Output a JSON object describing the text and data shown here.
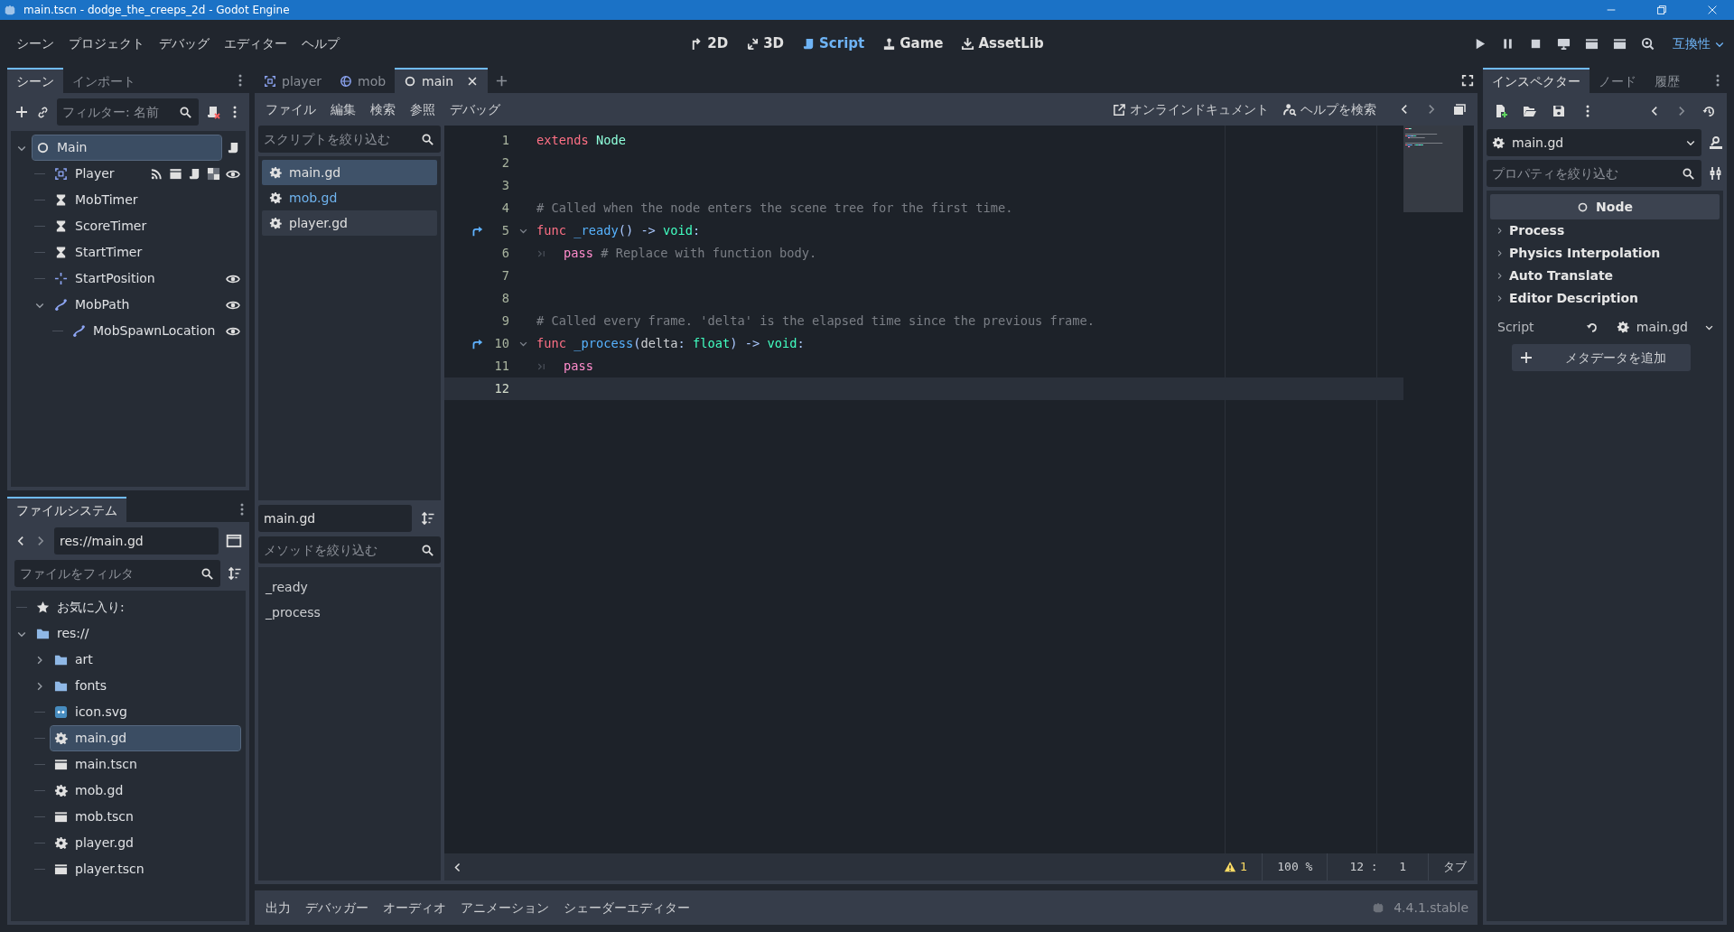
{
  "window": {
    "title": "main.tscn - dodge_the_creeps_2d - Godot Engine"
  },
  "menu": [
    "シーン",
    "プロジェクト",
    "デバッグ",
    "エディター",
    "ヘルプ"
  ],
  "workspaces": [
    {
      "kind": "flat",
      "label": "2D",
      "selected": false
    },
    {
      "kind": "spatial",
      "label": "3D",
      "selected": false
    },
    {
      "kind": "script",
      "label": "Script",
      "selected": true
    },
    {
      "kind": "game",
      "label": "Game",
      "selected": false
    },
    {
      "kind": "assetlib",
      "label": "AssetLib",
      "selected": false
    }
  ],
  "renderer": "互換性",
  "scene_dock": {
    "tabs": [
      {
        "label": "シーン",
        "selected": true
      },
      {
        "label": "インポート",
        "selected": false
      }
    ],
    "filter": {
      "placeholder": "フィルター: 名前"
    },
    "tree": [
      {
        "name": "Main",
        "kind": "node",
        "selected": true,
        "expanded": true,
        "signals": false,
        "groups": false,
        "script": true,
        "editable": false,
        "children": [
          {
            "name": "Player",
            "kind": "area",
            "selected": false,
            "signals": true,
            "groups": true,
            "script": true,
            "editable": true,
            "visible": true
          },
          {
            "name": "MobTimer",
            "kind": "timer",
            "selected": false,
            "signals": false,
            "groups": false,
            "script": false,
            "editable": false
          },
          {
            "name": "ScoreTimer",
            "kind": "timer",
            "selected": false,
            "signals": false,
            "groups": false,
            "script": false,
            "editable": false
          },
          {
            "name": "StartTimer",
            "kind": "timer",
            "selected": false,
            "signals": false,
            "groups": false,
            "script": false,
            "editable": false
          },
          {
            "name": "StartPosition",
            "kind": "marker",
            "selected": false,
            "signals": false,
            "groups": false,
            "script": false,
            "editable": false,
            "visible": true
          },
          {
            "name": "MobPath",
            "kind": "path",
            "selected": false,
            "expanded": true,
            "signals": false,
            "groups": false,
            "script": false,
            "editable": false,
            "visible": true,
            "children": [
              {
                "name": "MobSpawnLocation",
                "kind": "path_follow",
                "selected": false,
                "signals": false,
                "groups": false,
                "script": false,
                "editable": false,
                "visible": true
              }
            ]
          }
        ]
      }
    ]
  },
  "filesystem": {
    "tab": "ファイルシステム",
    "path": "res://main.gd",
    "filter": {
      "placeholder": "ファイルをフィルタ"
    },
    "tree": [
      {
        "kind": "favorites",
        "name": "お気に入り:",
        "selected": false
      },
      {
        "kind": "folder",
        "name": "res://",
        "selected": false,
        "expanded": true,
        "children": [
          {
            "kind": "folder",
            "name": "art",
            "selected": false,
            "expanded": false
          },
          {
            "kind": "folder",
            "name": "fonts",
            "selected": false,
            "expanded": false
          },
          {
            "kind": "image",
            "name": "icon.svg",
            "selected": false
          },
          {
            "kind": "script",
            "name": "main.gd",
            "selected": true
          },
          {
            "kind": "scene",
            "name": "main.tscn",
            "selected": false
          },
          {
            "kind": "script",
            "name": "mob.gd",
            "selected": false
          },
          {
            "kind": "scene",
            "name": "mob.tscn",
            "selected": false
          },
          {
            "kind": "script",
            "name": "player.gd",
            "selected": false
          },
          {
            "kind": "scene",
            "name": "player.tscn",
            "selected": false
          }
        ]
      }
    ]
  },
  "editor_tabs": [
    {
      "kind": "scene2d",
      "label": "player",
      "selected": false
    },
    {
      "kind": "rigid",
      "label": "mob",
      "selected": false
    },
    {
      "kind": "node",
      "label": "main",
      "selected": true
    }
  ],
  "script_menu": [
    "ファイル",
    "編集",
    "検索",
    "参照",
    "デバッグ"
  ],
  "script_links": [
    {
      "kind": "external",
      "label": "オンラインドキュメント"
    },
    {
      "kind": "help",
      "label": "ヘルプを検索"
    }
  ],
  "script_list": {
    "filter": {
      "placeholder": "スクリプトを絞り込む"
    },
    "items": [
      {
        "name": "main.gd",
        "selected": true,
        "hovered": false,
        "highlighted": false
      },
      {
        "name": "mob.gd",
        "selected": false,
        "hovered": false,
        "highlighted": true
      },
      {
        "name": "player.gd",
        "selected": false,
        "hovered": true,
        "highlighted": false
      }
    ]
  },
  "current_script": "main.gd",
  "method_filter": {
    "placeholder": "メソッドを絞り込む"
  },
  "methods": [
    "_ready",
    "_process"
  ],
  "code": {
    "lines": [
      {
        "number": "1",
        "connected": false,
        "foldable": false,
        "indented": false,
        "current": false,
        "tokens": [
          {
            "kind": "keyword",
            "text": "extends"
          },
          {
            "kind": "engine_type",
            "text": " Node"
          }
        ]
      },
      {
        "number": "2",
        "connected": false,
        "foldable": false,
        "indented": false,
        "current": false
      },
      {
        "number": "3",
        "connected": false,
        "foldable": false,
        "indented": false,
        "current": false
      },
      {
        "number": "4",
        "connected": false,
        "foldable": false,
        "indented": false,
        "current": false,
        "tokens": [
          {
            "kind": "comment",
            "text": "# Called when the node enters the scene tree for the first time."
          }
        ]
      },
      {
        "number": "5",
        "connected": true,
        "foldable": true,
        "indented": false,
        "current": false,
        "tokens": [
          {
            "kind": "keyword",
            "text": "func"
          },
          {
            "kind": "function",
            "text": " _ready"
          },
          {
            "kind": "symbol",
            "text": "() -> "
          },
          {
            "kind": "type",
            "text": "void"
          },
          {
            "kind": "symbol",
            "text": ":"
          }
        ]
      },
      {
        "number": "6",
        "connected": false,
        "foldable": false,
        "indented": true,
        "current": false,
        "tokens": [
          {
            "kind": "control",
            "text": "pass"
          },
          {
            "kind": "comment",
            "text": " # Replace with function body."
          }
        ]
      },
      {
        "number": "7",
        "connected": false,
        "foldable": false,
        "indented": false,
        "current": false
      },
      {
        "number": "8",
        "connected": false,
        "foldable": false,
        "indented": false,
        "current": false
      },
      {
        "number": "9",
        "connected": false,
        "foldable": false,
        "indented": false,
        "current": false,
        "tokens": [
          {
            "kind": "comment",
            "text": "# Called every frame. 'delta' is the elapsed time since the previous frame."
          }
        ]
      },
      {
        "number": "10",
        "connected": true,
        "foldable": true,
        "indented": false,
        "current": false,
        "tokens": [
          {
            "kind": "keyword",
            "text": "func"
          },
          {
            "kind": "function",
            "text": " _process"
          },
          {
            "kind": "symbol",
            "text": "("
          },
          {
            "kind": "plain",
            "text": "delta"
          },
          {
            "kind": "symbol",
            "text": ": "
          },
          {
            "kind": "type",
            "text": "float"
          },
          {
            "kind": "symbol",
            "text": ") -> "
          },
          {
            "kind": "type",
            "text": "void"
          },
          {
            "kind": "symbol",
            "text": ":"
          }
        ]
      },
      {
        "number": "11",
        "connected": false,
        "foldable": false,
        "indented": true,
        "current": false,
        "tokens": [
          {
            "kind": "control",
            "text": "pass"
          }
        ]
      },
      {
        "number": "12",
        "connected": false,
        "foldable": false,
        "indented": false,
        "current": true
      }
    ]
  },
  "status": {
    "warnings": "1",
    "zoom": "100 %",
    "cursor": "12 :   1",
    "indent": "タブ"
  },
  "bottom_tabs": [
    "出力",
    "デバッガー",
    "オーディオ",
    "アニメーション",
    "シェーダーエディター"
  ],
  "version": "4.4.1.stable",
  "inspector": {
    "tabs": [
      {
        "label": "インスペクター",
        "selected": true
      },
      {
        "label": "ノード",
        "selected": false
      },
      {
        "label": "履歴",
        "selected": false
      }
    ],
    "resource": "main.gd",
    "filter": {
      "placeholder": "プロパティを絞り込む"
    },
    "class": "Node",
    "groups": [
      {
        "label": "Process",
        "expanded": false
      },
      {
        "label": "Physics Interpolation",
        "expanded": false
      },
      {
        "label": "Auto Translate",
        "expanded": false
      },
      {
        "label": "Editor Description",
        "expanded": false
      }
    ],
    "script": {
      "label": "Script",
      "value": "main.gd"
    },
    "add_metadata": "メタデータを追加"
  }
}
